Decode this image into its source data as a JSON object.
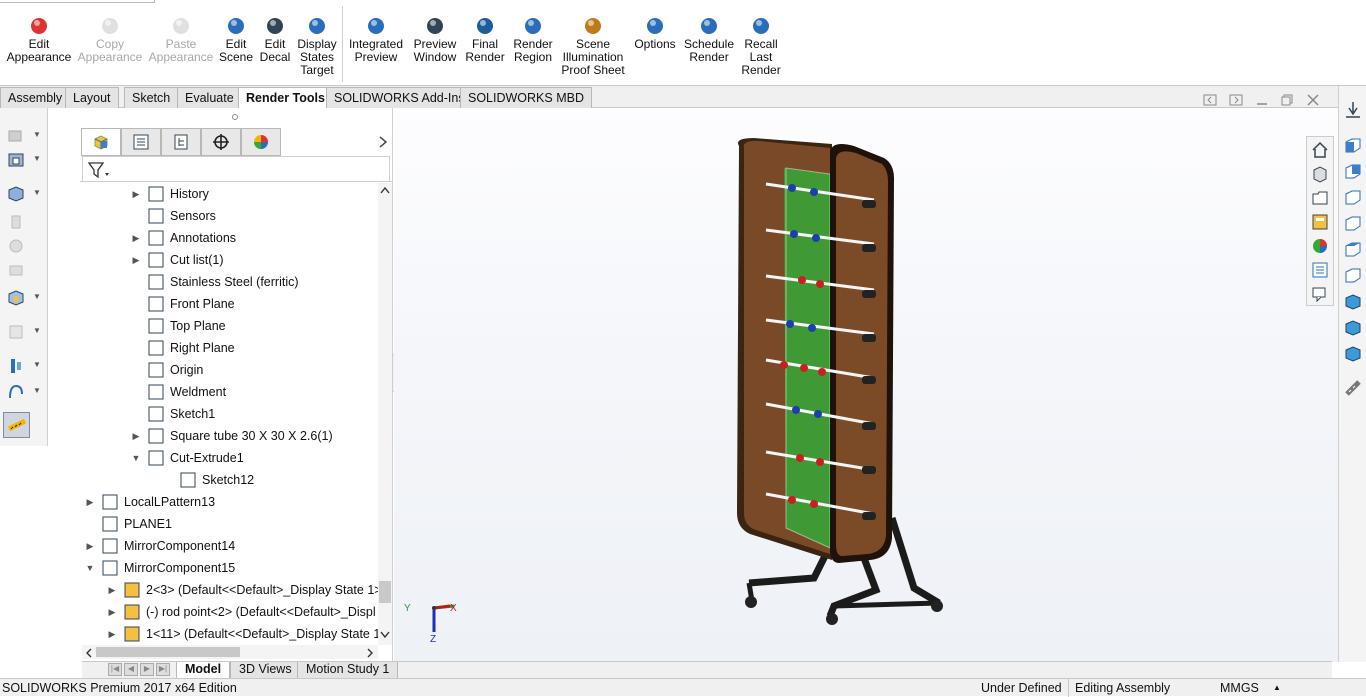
{
  "ribbon": {
    "buttons": [
      {
        "label": "Edit\nAppearance",
        "enabled": true,
        "icon": "edit-appearance-icon"
      },
      {
        "label": "Copy\nAppearance",
        "enabled": false,
        "icon": "copy-appearance-icon"
      },
      {
        "label": "Paste\nAppearance",
        "enabled": false,
        "icon": "paste-appearance-icon"
      },
      {
        "label": "Edit\nScene",
        "enabled": true,
        "icon": "edit-scene-icon"
      },
      {
        "label": "Edit\nDecal",
        "enabled": true,
        "icon": "edit-decal-icon"
      },
      {
        "label": "Display\nStates\nTarget",
        "enabled": true,
        "icon": "display-states-target-icon"
      },
      {
        "label": "Integrated\nPreview",
        "enabled": true,
        "icon": "integrated-preview-icon"
      },
      {
        "label": "Preview\nWindow",
        "enabled": true,
        "icon": "preview-window-icon"
      },
      {
        "label": "Final\nRender",
        "enabled": true,
        "icon": "final-render-icon"
      },
      {
        "label": "Render\nRegion",
        "enabled": true,
        "icon": "render-region-icon"
      },
      {
        "label": "Scene\nIllumination\nProof Sheet",
        "enabled": true,
        "icon": "scene-illumination-icon"
      },
      {
        "label": "Options",
        "enabled": true,
        "icon": "options-icon"
      },
      {
        "label": "Schedule\nRender",
        "enabled": true,
        "icon": "schedule-render-icon"
      },
      {
        "label": "Recall\nLast\nRender",
        "enabled": true,
        "icon": "recall-last-render-icon"
      }
    ]
  },
  "tabs": [
    {
      "label": "Assembly"
    },
    {
      "label": "Layout"
    },
    {
      "label": "Sketch"
    },
    {
      "label": "Evaluate"
    },
    {
      "label": "Render Tools",
      "active": true
    },
    {
      "label": "SOLIDWORKS Add-Ins"
    },
    {
      "label": "SOLIDWORKS MBD"
    }
  ],
  "tree": [
    {
      "label": "History",
      "indent": 1,
      "expander": "right"
    },
    {
      "label": "Sensors",
      "indent": 1,
      "expander": ""
    },
    {
      "label": "Annotations",
      "indent": 1,
      "expander": "right"
    },
    {
      "label": "Cut list(1)",
      "indent": 1,
      "expander": "right"
    },
    {
      "label": "Stainless Steel (ferritic)",
      "indent": 1,
      "expander": ""
    },
    {
      "label": "Front Plane",
      "indent": 1,
      "expander": ""
    },
    {
      "label": "Top Plane",
      "indent": 1,
      "expander": ""
    },
    {
      "label": "Right Plane",
      "indent": 1,
      "expander": ""
    },
    {
      "label": "Origin",
      "indent": 1,
      "expander": ""
    },
    {
      "label": "Weldment",
      "indent": 1,
      "expander": ""
    },
    {
      "label": "Sketch1",
      "indent": 1,
      "expander": ""
    },
    {
      "label": "Square tube 30 X 30 X 2.6(1)",
      "indent": 1,
      "expander": "right"
    },
    {
      "label": "Cut-Extrude1",
      "indent": 1,
      "expander": "down"
    },
    {
      "label": "Sketch12",
      "indent": 2,
      "expander": ""
    },
    {
      "label": "LocalLPattern13",
      "indent": 0,
      "expander": "right"
    },
    {
      "label": "PLANE1",
      "indent": 0,
      "expander": ""
    },
    {
      "label": "MirrorComponent14",
      "indent": 0,
      "expander": "right"
    },
    {
      "label": "MirrorComponent15",
      "indent": 0,
      "expander": "down"
    },
    {
      "label": "2<3> (Default<<Default>_Display State 1>",
      "indent": 0.5,
      "expander": "right"
    },
    {
      "label": "(-) rod point<2> (Default<<Default>_Displ",
      "indent": 0.5,
      "expander": "right"
    },
    {
      "label": "1<11> (Default<<Default>_Display State 1:",
      "indent": 0.5,
      "expander": "right"
    }
  ],
  "bottom_tabs": [
    {
      "label": "Model",
      "active": true
    },
    {
      "label": "3D Views"
    },
    {
      "label": "Motion Study 1"
    }
  ],
  "status": {
    "edition": "SOLIDWORKS Premium 2017 x64 Edition",
    "definition": "Under Defined",
    "mode": "Editing Assembly",
    "units": "MMGS",
    "units_arrow": "▲"
  },
  "triad": {
    "x": "X",
    "y": "Y",
    "z": "Z"
  }
}
